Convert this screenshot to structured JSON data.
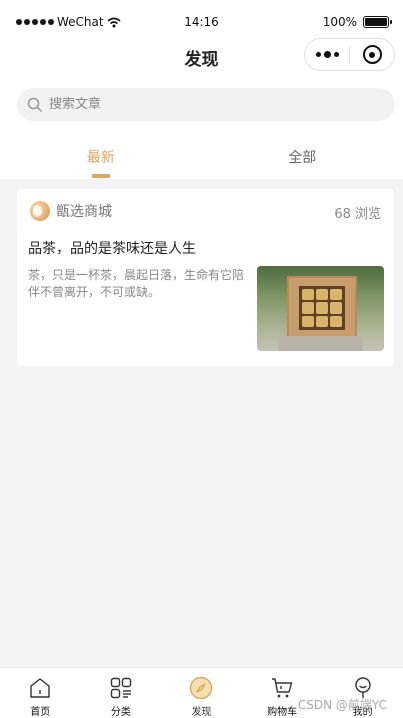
{
  "status_bar": {
    "carrier": "WeChat",
    "time": "14:16",
    "battery": "100%"
  },
  "nav": {
    "title": "发现"
  },
  "search": {
    "placeholder": "搜索文章"
  },
  "tabs": [
    {
      "label": "最新",
      "active": true
    },
    {
      "label": "全部",
      "active": false
    }
  ],
  "article": {
    "shop_name": "甑选商城",
    "views": "68 浏览",
    "title": "品茶，品的是茶味还是人生",
    "description": "茶，只是一杯茶，晨起日落，生命有它陪伴不曾离开，不可或缺。"
  },
  "tabbar": [
    {
      "label": "首页",
      "icon": "home-icon"
    },
    {
      "label": "分类",
      "icon": "category-icon"
    },
    {
      "label": "发现",
      "icon": "compass-icon",
      "active": true
    },
    {
      "label": "购物车",
      "icon": "cart-icon"
    },
    {
      "label": "我的",
      "icon": "user-icon"
    }
  ],
  "watermark": "CSDN @前端YC",
  "colors": {
    "accent": "#d9a760",
    "background": "#f4f4f4"
  }
}
